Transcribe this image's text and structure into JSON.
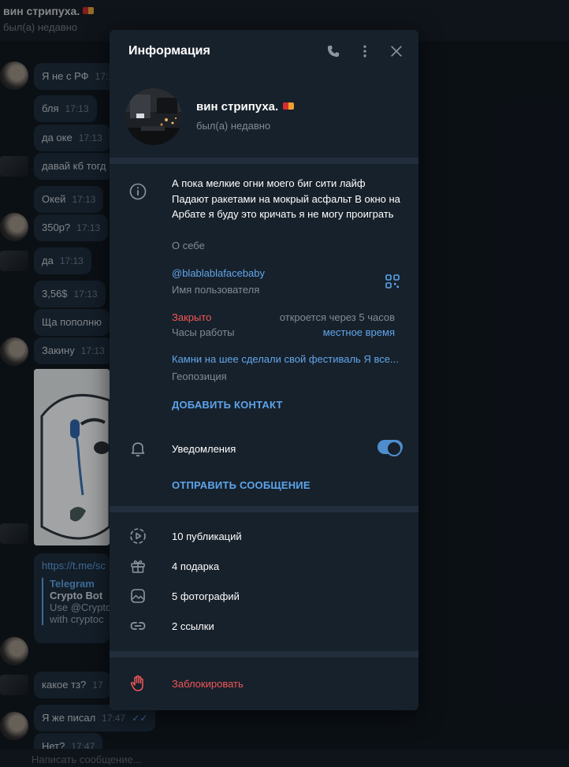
{
  "chat": {
    "title": "вин стрипуха.",
    "status": "был(а) недавно",
    "messages": [
      {
        "text": "Я не с РФ",
        "time": "17:13"
      },
      {
        "text": "бля",
        "time": "17:13"
      },
      {
        "text": "да оке",
        "time": "17:13"
      },
      {
        "text": "давай кб тогд",
        "time": ""
      },
      {
        "text": "Окей",
        "time": "17:13"
      },
      {
        "text": "350р?",
        "time": "17:13"
      },
      {
        "text": "да",
        "time": "17:13"
      },
      {
        "text": "3,56$",
        "time": "17:13"
      },
      {
        "text": "Ща пополню",
        "time": ""
      },
      {
        "text": "Закину",
        "time": "17:13"
      },
      {
        "text": "какое тз?",
        "time": "17"
      },
      {
        "text": "Я же писал",
        "time": "17:47"
      },
      {
        "text": "Нет?",
        "time": "17:47"
      }
    ],
    "link_card": {
      "url": "https://t.me/sc",
      "source": "Telegram",
      "title": "Crypto Bot",
      "line1": "Use @Crypto",
      "line2": "with cryptoc"
    },
    "composer_placeholder": "Написать сообщение..."
  },
  "panel": {
    "title": "Информация",
    "profile": {
      "name": "вин стрипуха.",
      "status": "был(а) недавно"
    },
    "bio": {
      "text": "А пока мелкие огни моего биг сити лайф Падают ракетами на мокрый асфальт В окно на Арбате я буду это кричать я не могу проиграть",
      "label": "О себе"
    },
    "username": {
      "value": "@blablablafacebaby",
      "label": "Имя пользователя"
    },
    "hours": {
      "state": "Закрыто",
      "opens": "откроется через 5 часов",
      "label": "Часы работы",
      "local_time": "местное время"
    },
    "location": {
      "value": "Камни на шее сделали свой фестиваль Я все...",
      "label": "Геопозиция"
    },
    "add_contact": "ДОБАВИТЬ КОНТАКТ",
    "notifications": {
      "label": "Уведомления",
      "enabled": true
    },
    "send_message": "ОТПРАВИТЬ СООБЩЕНИЕ",
    "media": {
      "posts": "10 публикаций",
      "gifts": "4 подарка",
      "photos": "5 фотографий",
      "links": "2 ссылки"
    },
    "block": "Заблокировать"
  },
  "colors": {
    "panel_bg": "#17212b",
    "accent": "#5ca4eb",
    "danger": "#f05757",
    "muted": "#7f8b96"
  }
}
